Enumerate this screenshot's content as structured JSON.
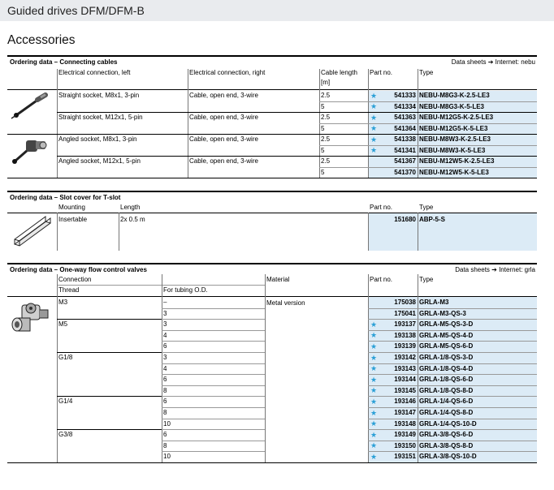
{
  "header": {
    "title": "Guided drives DFM/DFM-B"
  },
  "heading": "Accessories",
  "star_glyph": "★",
  "accent_blue": "#dcebf6",
  "star_color": "#2a9fd6",
  "cables": {
    "title": "Ordering data – Connecting cables",
    "datasheets": "Data sheets ➔ Internet: nebu",
    "headers": {
      "left": "Electrical connection, left",
      "right": "Electrical connection, right",
      "len": "Cable length",
      "len_unit": "[m]",
      "part": "Part no.",
      "type": "Type"
    },
    "groups": [
      {
        "left": "Straight socket, M8x1, 3-pin",
        "right": "Cable, open end, 3-wire"
      },
      {
        "left": "Straight socket, M12x1, 5-pin",
        "right": "Cable, open end, 3-wire"
      },
      {
        "left": "Angled socket, M8x1, 3-pin",
        "right": "Cable, open end, 3-wire"
      },
      {
        "left": "Angled socket, M12x1, 5-pin",
        "right": "Cable, open end, 3-wire"
      }
    ],
    "rows": [
      {
        "len": "2.5",
        "part": "541333",
        "type": "NEBU-M8G3-K-2.5-LE3",
        "star": true
      },
      {
        "len": "5",
        "part": "541334",
        "type": "NEBU-M8G3-K-5-LE3",
        "star": true
      },
      {
        "len": "2.5",
        "part": "541363",
        "type": "NEBU-M12G5-K-2.5-LE3",
        "star": true
      },
      {
        "len": "5",
        "part": "541364",
        "type": "NEBU-M12G5-K-5-LE3",
        "star": true
      },
      {
        "len": "2.5",
        "part": "541338",
        "type": "NEBU-M8W3-K-2.5-LE3",
        "star": true
      },
      {
        "len": "5",
        "part": "541341",
        "type": "NEBU-M8W3-K-5-LE3",
        "star": true
      },
      {
        "len": "2.5",
        "part": "541367",
        "type": "NEBU-M12W5-K-2.5-LE3",
        "star": false
      },
      {
        "len": "5",
        "part": "541370",
        "type": "NEBU-M12W5-K-5-LE3",
        "star": false
      }
    ]
  },
  "slot": {
    "title": "Ordering data – Slot cover for T-slot",
    "headers": {
      "mounting": "Mounting",
      "length": "Length",
      "part": "Part no.",
      "type": "Type"
    },
    "row": {
      "mounting": "Insertable",
      "length": "2x 0.5 m",
      "part": "151680",
      "type": "ABP-5-S"
    }
  },
  "flow": {
    "title": "Ordering data – One-way flow control valves",
    "datasheets": "Data sheets ➔ Internet: grla",
    "headers": {
      "connection": "Connection",
      "thread": "Thread",
      "tubing": "For tubing O.D.",
      "material": "Material",
      "part": "Part no.",
      "type": "Type"
    },
    "material": "Metal version",
    "threads": [
      "M3",
      "M5",
      "G1/8",
      "G1/4",
      "G3/8"
    ],
    "rows": [
      {
        "od": "–",
        "part": "175038",
        "type": "GRLA-M3",
        "star": false
      },
      {
        "od": "3",
        "part": "175041",
        "type": "GRLA-M3-QS-3",
        "star": false
      },
      {
        "od": "3",
        "part": "193137",
        "type": "GRLA-M5-QS-3-D",
        "star": true
      },
      {
        "od": "4",
        "part": "193138",
        "type": "GRLA-M5-QS-4-D",
        "star": true
      },
      {
        "od": "6",
        "part": "193139",
        "type": "GRLA-M5-QS-6-D",
        "star": true
      },
      {
        "od": "3",
        "part": "193142",
        "type": "GRLA-1/8-QS-3-D",
        "star": true
      },
      {
        "od": "4",
        "part": "193143",
        "type": "GRLA-1/8-QS-4-D",
        "star": true
      },
      {
        "od": "6",
        "part": "193144",
        "type": "GRLA-1/8-QS-6-D",
        "star": true
      },
      {
        "od": "8",
        "part": "193145",
        "type": "GRLA-1/8-QS-8-D",
        "star": true
      },
      {
        "od": "6",
        "part": "193146",
        "type": "GRLA-1/4-QS-6-D",
        "star": true
      },
      {
        "od": "8",
        "part": "193147",
        "type": "GRLA-1/4-QS-8-D",
        "star": true
      },
      {
        "od": "10",
        "part": "193148",
        "type": "GRLA-1/4-QS-10-D",
        "star": true
      },
      {
        "od": "6",
        "part": "193149",
        "type": "GRLA-3/8-QS-6-D",
        "star": true
      },
      {
        "od": "8",
        "part": "193150",
        "type": "GRLA-3/8-QS-8-D",
        "star": true
      },
      {
        "od": "10",
        "part": "193151",
        "type": "GRLA-3/8-QS-10-D",
        "star": true
      }
    ]
  }
}
